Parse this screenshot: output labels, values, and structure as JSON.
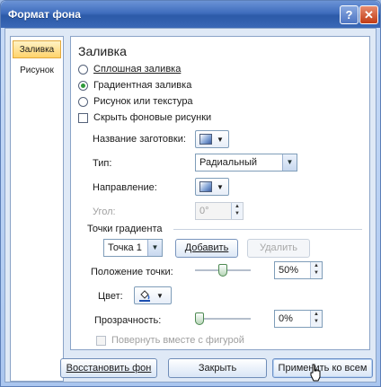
{
  "window": {
    "title": "Формат фона",
    "help_glyph": "?",
    "close_glyph": "✕"
  },
  "nav": {
    "items": [
      {
        "label": "Заливка"
      },
      {
        "label": "Рисунок"
      }
    ]
  },
  "fill": {
    "heading": "Заливка",
    "radios": [
      {
        "label": "Сплошная заливка",
        "checked": false
      },
      {
        "label": "Градиентная заливка",
        "checked": true
      },
      {
        "label": "Рисунок или текстура",
        "checked": false
      }
    ],
    "hide_bg_label": "Скрыть фоновые рисунки",
    "preset_label": "Название заготовки:",
    "type_label": "Тип:",
    "type_value": "Радиальный",
    "direction_label": "Направление:",
    "angle_label": "Угол:",
    "angle_value": "0°",
    "stops_label": "Точки градиента",
    "stop_value": "Точка 1",
    "add_label": "Добавить",
    "remove_label": "Удалить",
    "position_label": "Положение точки:",
    "position_value": "50%",
    "position_level": 0.5,
    "color_label": "Цвет:",
    "transparency_label": "Прозрачность:",
    "transparency_value": "0%",
    "transparency_level": 0.0,
    "rotate_label": "Повернуть вместе с фигурой"
  },
  "footer": {
    "reset_label": "Восстановить фон",
    "close_label": "Закрыть",
    "apply_all_label": "Применить ко всем"
  },
  "glyphs": {
    "caret": "▼",
    "spin_up": "▲",
    "spin_down": "▼"
  }
}
